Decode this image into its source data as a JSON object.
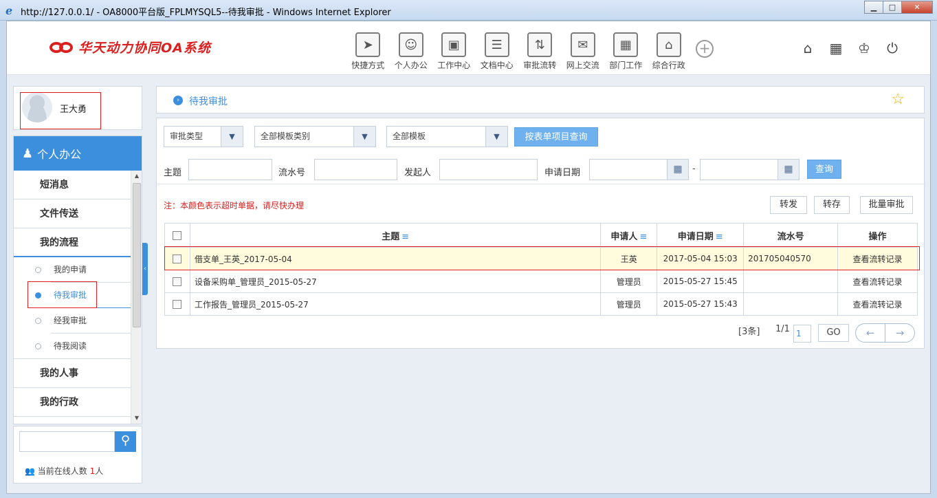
{
  "window": {
    "title": "http://127.0.0.1/ - OA8000平台版_FPLMYSQL5--待我审批 - Windows Internet Explorer",
    "minimize": "▁",
    "maximize": "□",
    "close": "✕"
  },
  "header": {
    "logo_text": "华天动力协同OA系统",
    "nav": [
      {
        "label": "快捷方式",
        "icon": "paper-plane-icon",
        "glyph": "➤"
      },
      {
        "label": "个人办公",
        "icon": "user-gear-icon",
        "glyph": "☺"
      },
      {
        "label": "工作中心",
        "icon": "briefcase-icon",
        "glyph": "▣"
      },
      {
        "label": "文档中心",
        "icon": "inbox-icon",
        "glyph": "☰"
      },
      {
        "label": "审批流转",
        "icon": "flow-arrows-icon",
        "glyph": "⇅"
      },
      {
        "label": "网上交流",
        "icon": "chat-icon",
        "glyph": "✉"
      },
      {
        "label": "部门工作",
        "icon": "building-icon",
        "glyph": "▦"
      },
      {
        "label": "综合行政",
        "icon": "institution-icon",
        "glyph": "⌂"
      }
    ],
    "add_glyph": "+",
    "tools": [
      {
        "name": "home-icon",
        "glyph": "⌂"
      },
      {
        "name": "grid-icon",
        "glyph": "▦"
      },
      {
        "name": "shirt-icon",
        "glyph": "♔"
      },
      {
        "name": "power-icon",
        "glyph": "⏻"
      }
    ]
  },
  "user": {
    "name": "王大勇"
  },
  "sidebar": {
    "section": "个人办公",
    "items": [
      {
        "label": "短消息",
        "level": 1
      },
      {
        "label": "文件传送",
        "level": 1
      },
      {
        "label": "我的流程",
        "level": 1
      },
      {
        "label": "我的申请",
        "level": 2
      },
      {
        "label": "待我审批",
        "level": 2
      },
      {
        "label": "经我审批",
        "level": 2
      },
      {
        "label": "待我阅读",
        "level": 2
      },
      {
        "label": "我的人事",
        "level": 1
      },
      {
        "label": "我的行政",
        "level": 1
      }
    ],
    "online_prefix": "当前在线人数",
    "online_count": "1",
    "online_suffix": "人"
  },
  "breadcrumb": {
    "title": "待我审批"
  },
  "filters": {
    "approval_type": "审批类型",
    "template_category": "全部模板类别",
    "template": "全部模板",
    "query_by_form_btn": "按表单项目查询",
    "subject_label": "主题",
    "serial_label": "流水号",
    "initiator_label": "发起人",
    "apply_date_label": "申请日期",
    "date_sep": "-",
    "query_btn": "查询"
  },
  "list": {
    "note": "注：本颜色表示超时单据，请尽快办理",
    "actions": [
      "转发",
      "转存",
      "批量审批"
    ],
    "columns": [
      "主题",
      "申请人",
      "申请日期",
      "流水号",
      "操作"
    ],
    "sort_glyph": "≡",
    "rows": [
      {
        "subject": "借支单_王英_2017-05-04",
        "applicant": "王英",
        "date": "2017-05-04 15:03",
        "serial": "201705040570",
        "action": "查看流转记录"
      },
      {
        "subject": "设备采购单_管理员_2015-05-27",
        "applicant": "管理员",
        "date": "2015-05-27 15:45",
        "serial": "",
        "action": "查看流转记录"
      },
      {
        "subject": "工作报告_管理员_2015-05-27",
        "applicant": "管理员",
        "date": "2015-05-27 15:43",
        "serial": "",
        "action": "查看流转记录"
      }
    ],
    "pager": {
      "total": "[3条]",
      "pages": "1/1",
      "page_input": "1",
      "go": "GO",
      "prev": "←",
      "next": "→"
    }
  },
  "colors": {
    "accent": "#3c8fdc",
    "warn": "#d9201f",
    "highlight": "#fffbdc"
  }
}
